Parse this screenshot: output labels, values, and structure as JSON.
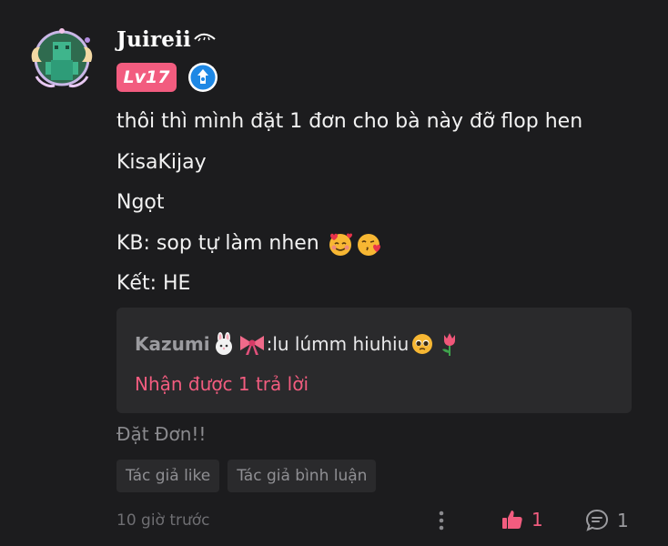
{
  "user": {
    "name": "Juireii",
    "level": "Lv17"
  },
  "colors": {
    "accent": "#f25c7f",
    "background": "#1c1c1e",
    "card": "#2a2a2c",
    "verified": "#1e88e5"
  },
  "icons": [
    "avatar",
    "verified-badge-icon",
    "more-vertical-icon",
    "thumbs-up-icon",
    "comment-icon"
  ],
  "post": {
    "lines": [
      "thôi thì mình đặt 1 đơn cho bà này đỡ flop hen",
      "KisaKijay",
      "Ngọt",
      "KB: sop tự làm nhen",
      "Kết: HE"
    ]
  },
  "reply": {
    "author": "Kazumi",
    "separator": ":",
    "text": " lu lúmm hiuhiu",
    "count_label": "Nhận được 1 trả lời"
  },
  "tag": "Đặt Đơn!!",
  "chips": [
    "Tác giả like",
    "Tác giả bình luận"
  ],
  "footer": {
    "time": "10 giờ trước",
    "likes": "1",
    "comments": "1"
  }
}
